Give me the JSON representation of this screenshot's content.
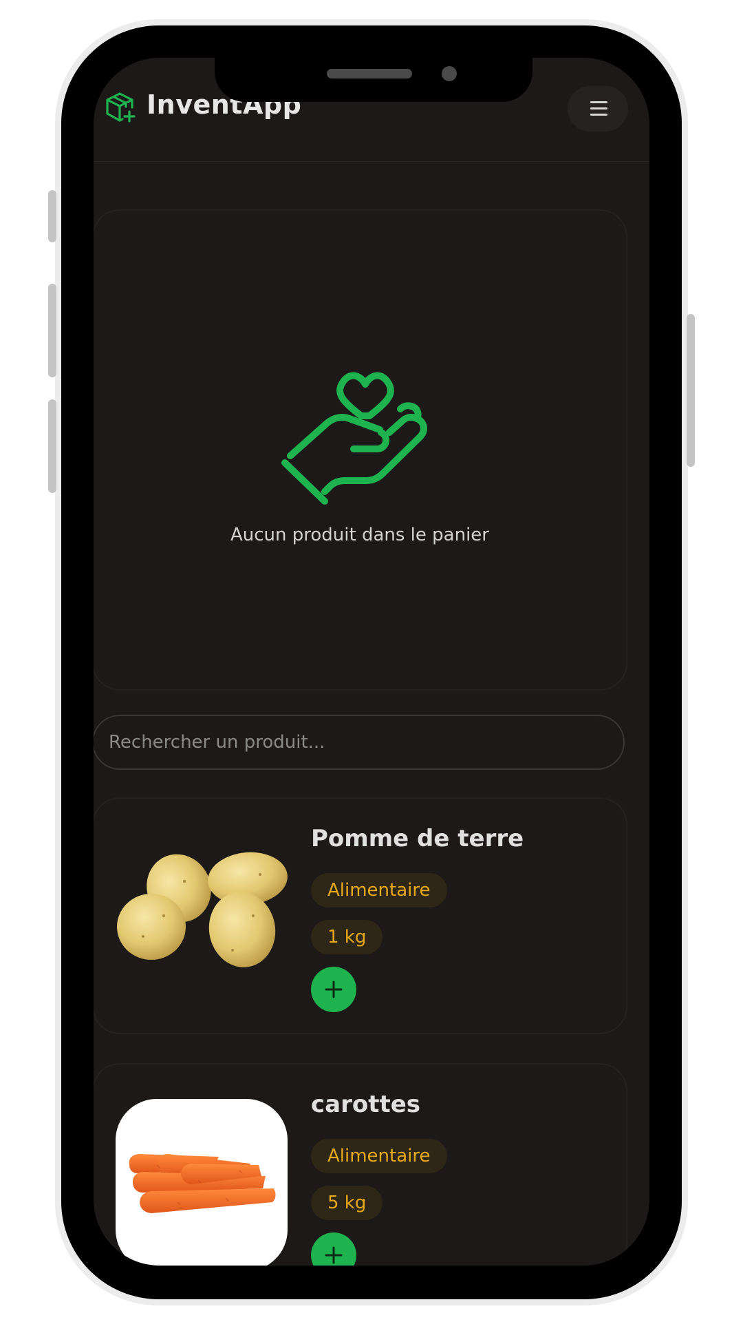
{
  "header": {
    "app_title": "InventApp",
    "logo_icon": "package-plus-icon",
    "menu_icon": "hamburger-menu-icon"
  },
  "cart": {
    "icon": "hand-heart-icon",
    "empty_message": "Aucun produit dans le panier"
  },
  "search": {
    "placeholder": "Rechercher un produit..."
  },
  "products": [
    {
      "name": "Pomme de terre",
      "category": "Alimentaire",
      "quantity": "1 kg",
      "image": "potatoes-image",
      "add_icon": "plus-icon"
    },
    {
      "name": "carottes",
      "category": "Alimentaire",
      "quantity": "5 kg",
      "image": "carrots-image",
      "add_icon": "plus-icon"
    }
  ],
  "colors": {
    "accent": "#1fb350",
    "background": "#1c1918",
    "badge_text": "#e7a81a",
    "badge_bg": "#2e2616"
  }
}
